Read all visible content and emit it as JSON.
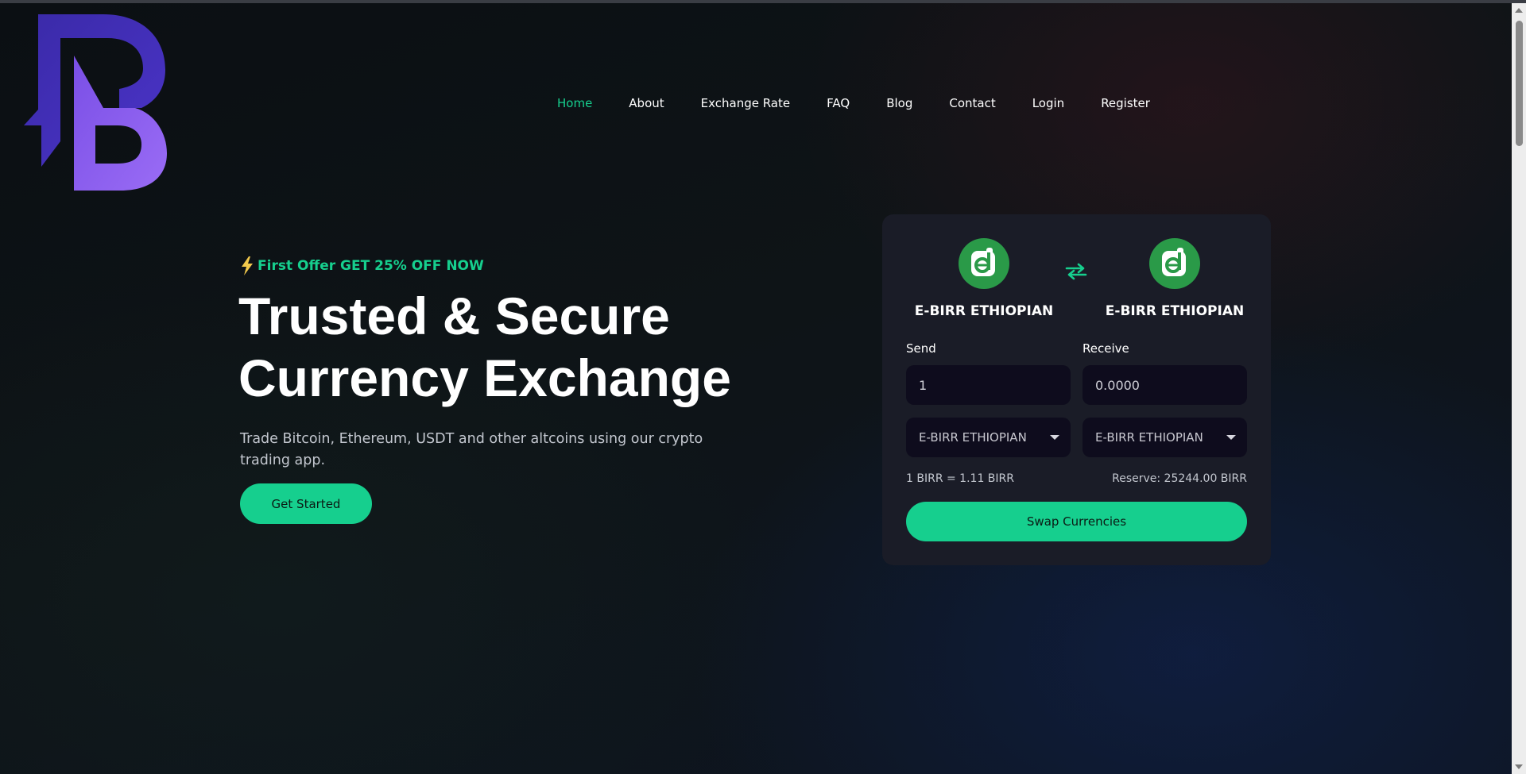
{
  "nav": {
    "items": [
      {
        "label": "Home",
        "active": true
      },
      {
        "label": "About",
        "active": false
      },
      {
        "label": "Exchange Rate",
        "active": false
      },
      {
        "label": "FAQ",
        "active": false
      },
      {
        "label": "Blog",
        "active": false
      },
      {
        "label": "Contact",
        "active": false
      },
      {
        "label": "Login",
        "active": false
      },
      {
        "label": "Register",
        "active": false
      }
    ]
  },
  "hero": {
    "offer": "First Offer GET 25% OFF NOW",
    "title_line1": "Trusted & Secure",
    "title_line2": "Currency Exchange",
    "subtitle": "Trade Bitcoin, Ethereum, USDT and other altcoins using our crypto trading app.",
    "cta_label": "Get Started"
  },
  "exchange": {
    "send_currency_name": "E-BIRR ETHIOPIAN",
    "receive_currency_name": "E-BIRR ETHIOPIAN",
    "send_label": "Send",
    "receive_label": "Receive",
    "send_amount": "1",
    "receive_amount": "0.0000",
    "send_select_value": "E-BIRR ETHIOPIAN",
    "receive_select_value": "E-BIRR ETHIOPIAN",
    "rate_text": "1 BIRR = 1.11 BIRR",
    "reserve_text": "Reserve: 25244.00 BIRR",
    "swap_button_label": "Swap Currencies"
  },
  "colors": {
    "accent": "#16cf8e",
    "card_bg": "#1a1c27",
    "input_bg": "#0e0c1d",
    "coin_green": "#2a9a48",
    "logo_purple_dark": "#3a2aa8",
    "logo_purple_light": "#8a5cf0"
  },
  "icons": {
    "logo": "brand-b-logo-icon",
    "offer": "lightning-bolt-icon",
    "coin": "ebirr-coin-icon",
    "swap": "swap-arrows-icon",
    "dropdown": "caret-down-icon"
  }
}
